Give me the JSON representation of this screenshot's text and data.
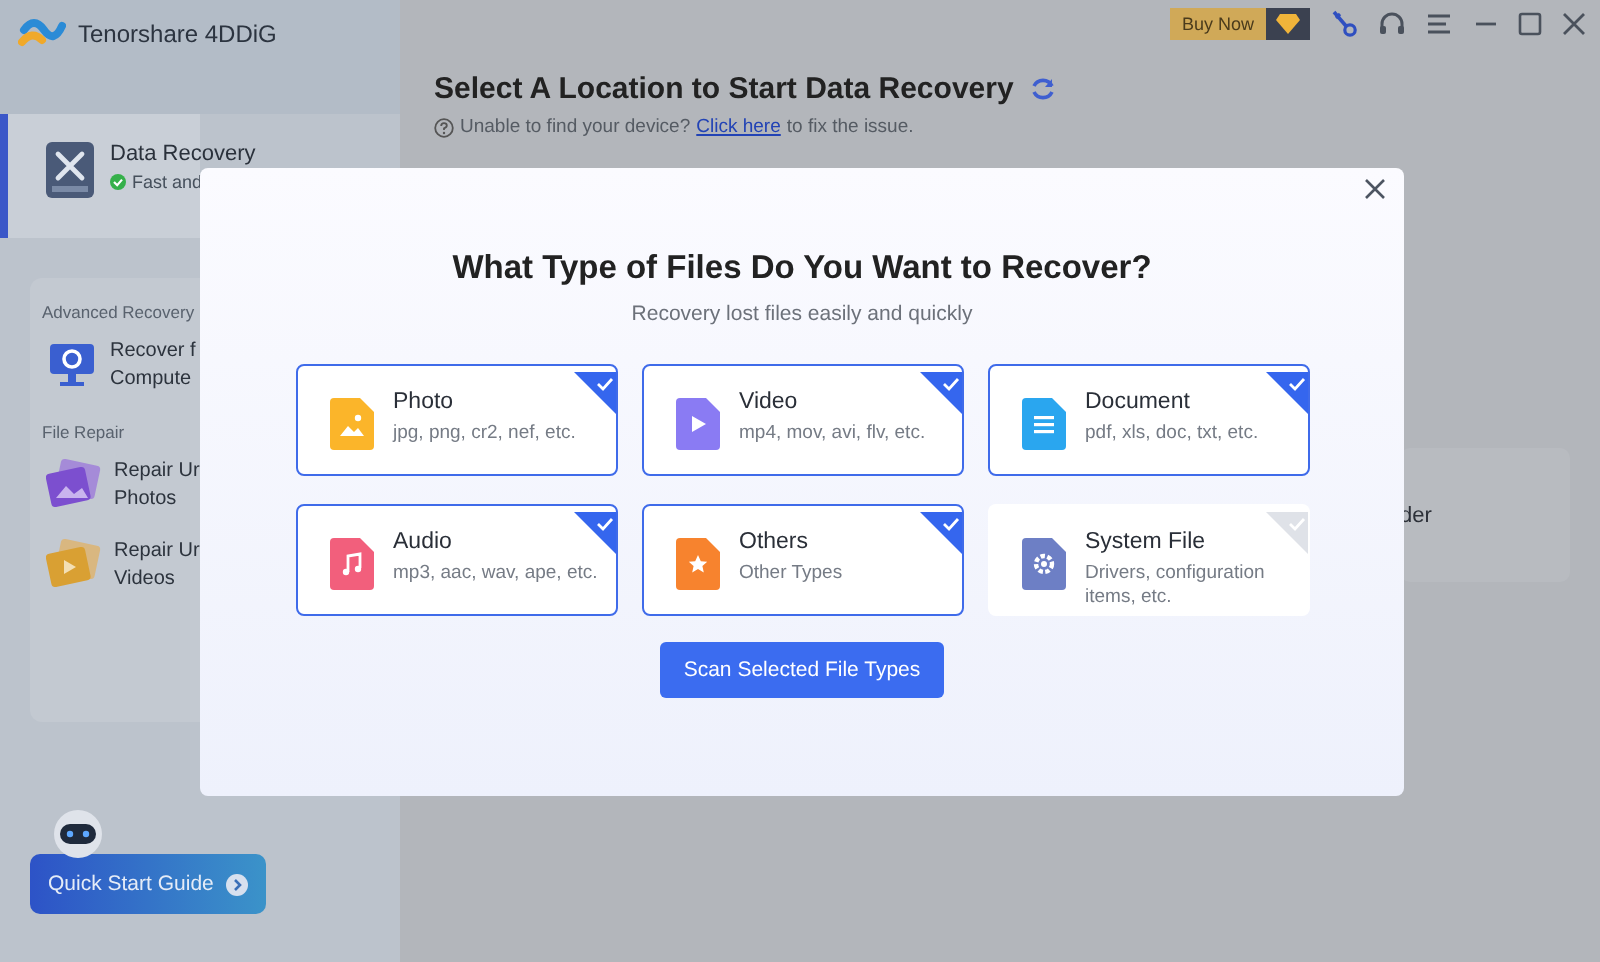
{
  "app": {
    "title": "Tenorshare 4DDiG"
  },
  "toolbar": {
    "buy_button": "Buy Now"
  },
  "sidebar": {
    "items": [
      {
        "title": "Data Recovery",
        "subtitle": "Fast and",
        "selected": true
      }
    ],
    "sections": [
      {
        "heading": "Advanced Recovery",
        "items": [
          {
            "kind": "computer",
            "lines": [
              "Recover f",
              "Compute"
            ]
          }
        ]
      },
      {
        "heading": "File Repair",
        "items": [
          {
            "kind": "photo",
            "lines": [
              "Repair Ur",
              "Photos"
            ]
          },
          {
            "kind": "video",
            "lines": [
              "Repair Ur",
              "Videos"
            ]
          }
        ]
      }
    ],
    "guide_button": "Quick Start Guide"
  },
  "main": {
    "title": "Select A Location to Start Data Recovery",
    "hint": "Unable to find your device?",
    "link": "Click here",
    "hint_end": "to fix the issue.",
    "location_card": {
      "label": "der"
    }
  },
  "dialog": {
    "title": "What Type of Files Do You Want to Recover?",
    "subtitle": "Recovery lost files easily and quickly",
    "file_types": [
      {
        "kind": "photo",
        "name": "Photo",
        "extensions": "jpg, png, cr2, nef, etc.",
        "selected": true
      },
      {
        "kind": "video",
        "name": "Video",
        "extensions": "mp4, mov, avi, flv, etc.",
        "selected": true
      },
      {
        "kind": "document",
        "name": "Document",
        "extensions": "pdf, xls, doc, txt, etc.",
        "selected": true
      },
      {
        "kind": "audio",
        "name": "Audio",
        "extensions": "mp3, aac, wav, ape, etc.",
        "selected": true
      },
      {
        "kind": "others",
        "name": "Others",
        "extensions": "Other Types",
        "selected": true
      },
      {
        "kind": "system",
        "name": "System File",
        "extensions": "Drivers, configuration items, etc.",
        "selected": false
      }
    ],
    "scan_button": "Scan Selected File Types"
  }
}
